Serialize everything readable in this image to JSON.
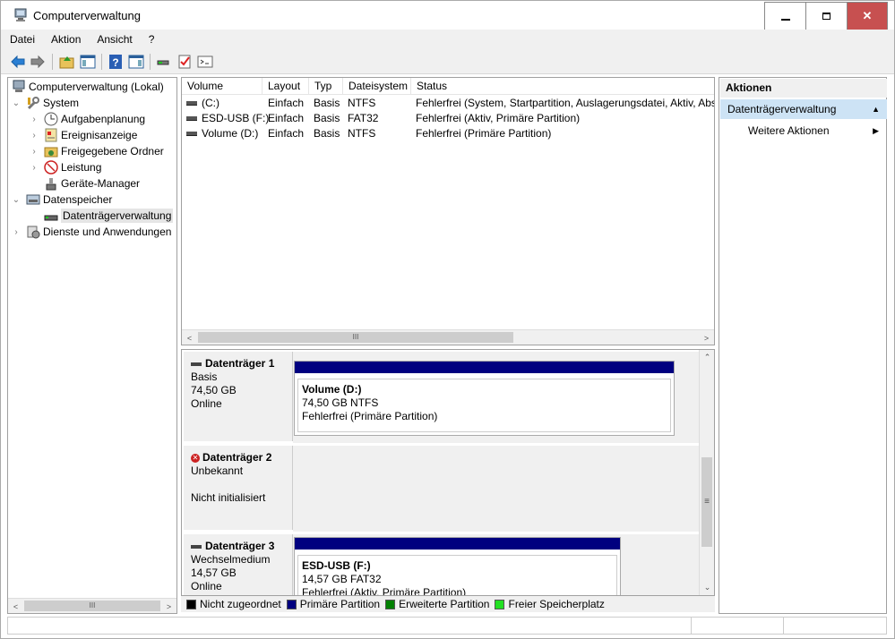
{
  "window": {
    "title": "Computerverwaltung",
    "controls": {
      "minimize": "▁",
      "maximize": "☐",
      "close": "✕"
    }
  },
  "menu": [
    "Datei",
    "Aktion",
    "Ansicht",
    "?"
  ],
  "tree": {
    "items": [
      {
        "label": "Computerverwaltung (Lokal)",
        "icon": "computer-management-icon"
      },
      {
        "label": "System",
        "icon": "system-tools-icon"
      },
      {
        "label": "Aufgabenplanung",
        "icon": "task-scheduler-icon"
      },
      {
        "label": "Ereignisanzeige",
        "icon": "event-viewer-icon"
      },
      {
        "label": "Freigegebene Ordner",
        "icon": "shared-folders-icon"
      },
      {
        "label": "Leistung",
        "icon": "performance-icon"
      },
      {
        "label": "Geräte-Manager",
        "icon": "device-manager-icon"
      },
      {
        "label": "Datenspeicher",
        "icon": "storage-icon"
      },
      {
        "label": "Datenträgerverwaltung",
        "icon": "disk-management-icon"
      },
      {
        "label": "Dienste und Anwendungen",
        "icon": "services-icon"
      }
    ]
  },
  "volumes": {
    "columns": [
      "Volume",
      "Layout",
      "Typ",
      "Dateisystem",
      "Status"
    ],
    "rows": [
      {
        "volume": "(C:)",
        "layout": "Einfach",
        "typ": "Basis",
        "fs": "NTFS",
        "status": "Fehlerfrei (System, Startpartition, Auslagerungsdatei, Aktiv, Abs"
      },
      {
        "volume": "ESD-USB (F:)",
        "layout": "Einfach",
        "typ": "Basis",
        "fs": "FAT32",
        "status": "Fehlerfrei (Aktiv, Primäre Partition)"
      },
      {
        "volume": "Volume (D:)",
        "layout": "Einfach",
        "typ": "Basis",
        "fs": "NTFS",
        "status": "Fehlerfrei (Primäre Partition)"
      }
    ]
  },
  "disks": [
    {
      "name": "Datenträger 1",
      "type": "Basis",
      "size": "74,50 GB",
      "state": "Online",
      "partition": {
        "name": "Volume  (D:)",
        "size": "74,50 GB NTFS",
        "status": "Fehlerfrei (Primäre Partition)"
      }
    },
    {
      "name": "Datenträger 2",
      "type": "Unbekannt",
      "size": "",
      "state": "Nicht initialisiert"
    },
    {
      "name": "Datenträger 3",
      "type": "Wechselmedium",
      "size": "14,57 GB",
      "state": "Online",
      "partition": {
        "name": "ESD-USB  (F:)",
        "size": "14,57 GB FAT32",
        "status": "Fehlerfrei (Aktiv, Primäre Partition)"
      }
    }
  ],
  "legend": [
    {
      "label": "Nicht zugeordnet",
      "color": "#000000"
    },
    {
      "label": "Primäre Partition",
      "color": "#00007f"
    },
    {
      "label": "Erweiterte Partition",
      "color": "#008000"
    },
    {
      "label": "Freier Speicherplatz",
      "color": "#22e022"
    }
  ],
  "actions": {
    "header": "Aktionen",
    "selected": "Datenträgerverwaltung",
    "item": "Weitere Aktionen"
  }
}
